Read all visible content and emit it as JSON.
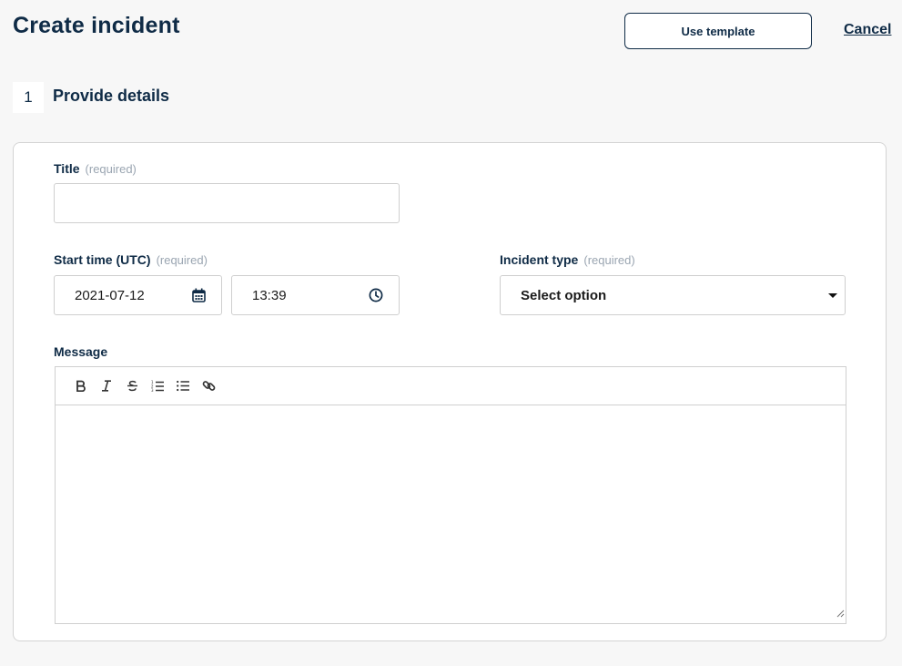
{
  "header": {
    "title": "Create incident",
    "use_template_label": "Use template",
    "cancel_label": "Cancel"
  },
  "step": {
    "number": "1",
    "title": "Provide details"
  },
  "form": {
    "title": {
      "label": "Title",
      "required": "(required)",
      "value": ""
    },
    "start_time": {
      "label": "Start time (UTC)",
      "required": "(required)",
      "date_value": "2021-07-12",
      "time_value": "13:39",
      "date_icon": "calendar-icon",
      "time_icon": "clock-icon"
    },
    "incident_type": {
      "label": "Incident type",
      "required": "(required)",
      "selected": "Select option"
    },
    "message": {
      "label": "Message",
      "value": "",
      "toolbar": [
        "bold",
        "italic",
        "strikethrough",
        "ordered-list",
        "bullet-list",
        "link"
      ]
    }
  },
  "colors": {
    "primary": "#0f2b46",
    "muted": "#9aa5b1",
    "background": "#f7f7f7",
    "border": "#cfcfcf"
  }
}
